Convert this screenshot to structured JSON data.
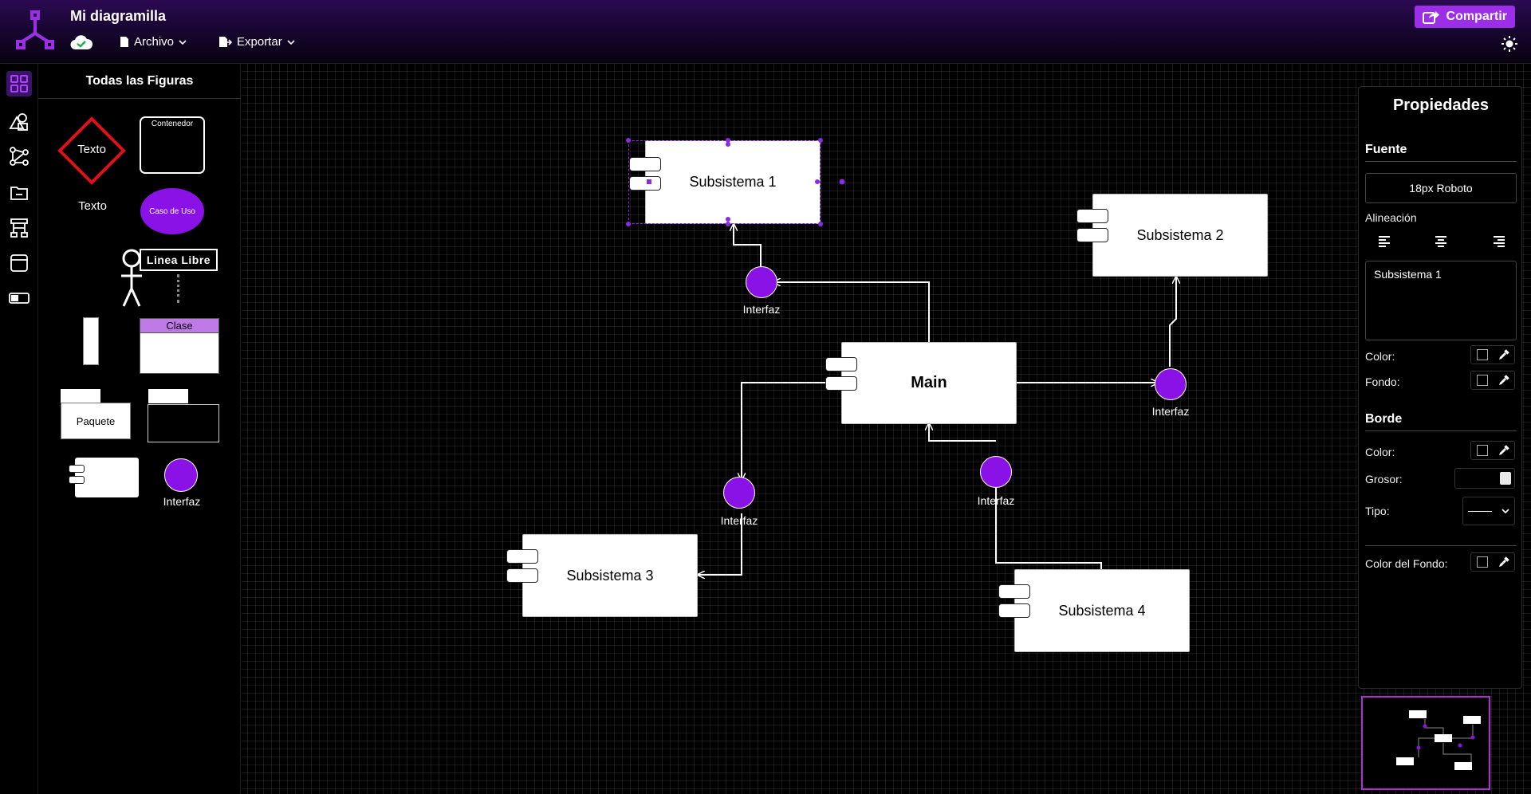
{
  "app": {
    "title": "Mi diagramilla",
    "menus": {
      "file": "Archivo",
      "export": "Exportar"
    },
    "share_label": "Compartir"
  },
  "rail": {
    "items": [
      "all-shapes",
      "shapes",
      "relations",
      "folder",
      "hierarchy",
      "window",
      "toggle"
    ]
  },
  "palette": {
    "title": "Todas las Figuras",
    "decision_text": "Texto",
    "container_text": "Contenedor",
    "text_label": "Texto",
    "usecase_text": "Caso de Uso",
    "freeline_text": "Linea Libre",
    "class_text": "Clase",
    "package_text": "Paquete",
    "interface_text": "Interfaz"
  },
  "diagram": {
    "components": {
      "s1": "Subsistema 1",
      "s2": "Subsistema 2",
      "main": "Main",
      "s3": "Subsistema 3",
      "s4": "Subsistema 4"
    },
    "interfaces": {
      "i1": "Interfaz",
      "i2": "Interfaz",
      "i3": "Interfaz",
      "i4": "Interfaz"
    }
  },
  "properties": {
    "title": "Propiedades",
    "font_section": "Fuente",
    "font_value": "18px Roboto",
    "alignment_label": "Alineación",
    "text_value": "Subsistema 1",
    "color_label": "Color:",
    "fill_label": "Fondo:",
    "border_section": "Borde",
    "border_color_label": "Color:",
    "thickness_label": "Grosor:",
    "type_label": "Tipo:",
    "bg_color_label": "Color del Fondo:"
  },
  "colors": {
    "accent": "#8a12e6",
    "share": "#9b2ee6",
    "selection": "#8a2be2"
  }
}
